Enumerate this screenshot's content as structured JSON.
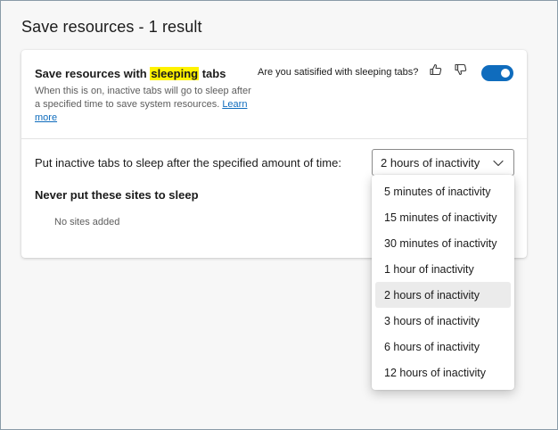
{
  "page": {
    "title": "Save resources - 1 result"
  },
  "setting": {
    "title_before": "Save resources with ",
    "title_highlight": "sleeping",
    "title_after": " tabs",
    "description": "When this is on, inactive tabs will go to sleep after a specified time to save system resources.",
    "learn_more": "Learn more",
    "feedback_question": "Are you satisified with sleeping tabs?",
    "thumbs_up_icon": "thumbs-up-icon",
    "thumbs_down_icon": "thumbs-down-icon",
    "toggle_on": true,
    "accent_color": "#0f6cbd"
  },
  "sleep": {
    "label": "Put inactive tabs to sleep after the specified amount of time:",
    "selected": "2 hours of inactivity",
    "chevron_icon": "chevron-down-icon",
    "options": [
      "5 minutes of inactivity",
      "15 minutes of inactivity",
      "30 minutes of inactivity",
      "1 hour of inactivity",
      "2 hours of inactivity",
      "3 hours of inactivity",
      "6 hours of inactivity",
      "12 hours of inactivity"
    ]
  },
  "never_sleep": {
    "title": "Never put these sites to sleep",
    "empty_text": "No sites added"
  }
}
